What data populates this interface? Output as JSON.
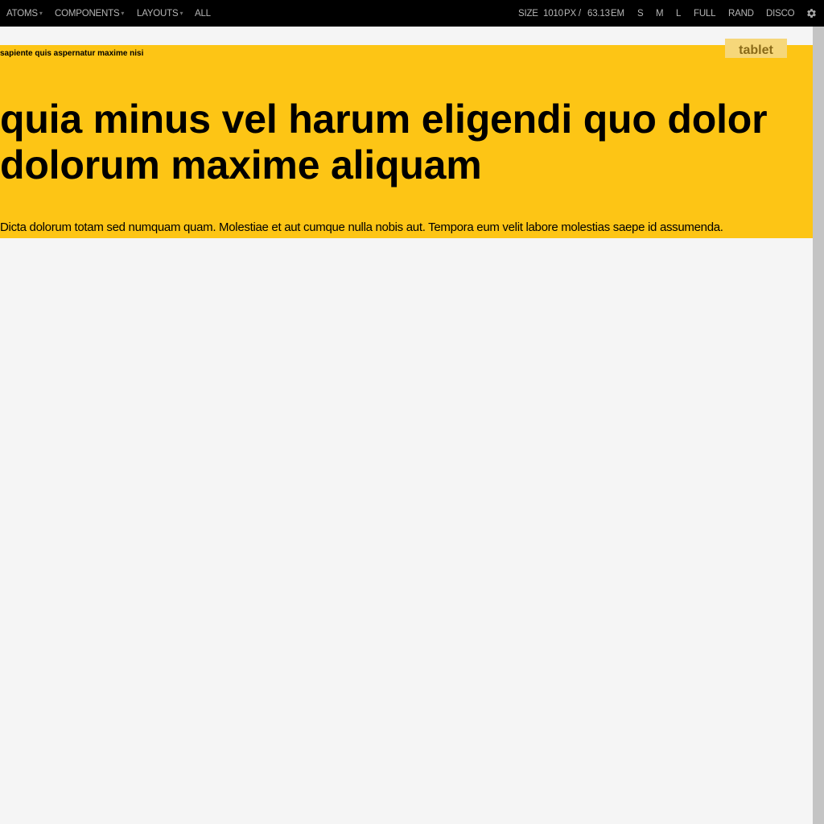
{
  "toolbar": {
    "nav": [
      {
        "label": "ATOMS",
        "caret": "▾"
      },
      {
        "label": "COMPONENTS",
        "caret": "▾"
      },
      {
        "label": "LAYOUTS",
        "caret": "▾"
      },
      {
        "label": "ALL"
      }
    ],
    "size_label": "SIZE",
    "size_px": "1010",
    "px_unit": "PX /",
    "size_em": "63.13",
    "em_unit": "EM",
    "buttons": [
      "S",
      "M",
      "L",
      "FULL",
      "RAND",
      "DISCO"
    ],
    "settings_icon": "gear-icon"
  },
  "viewport": {
    "breakpoint_tag": "tablet",
    "eyebrow": "sapiente quis aspernatur maxime nisi",
    "headline_line1": "quia minus vel harum eligendi quo dolor",
    "headline_line2": "dolorum maxime aliquam",
    "lede": "Dicta dolorum totam sed numquam quam. Molestiae et aut cumque nulla nobis aut. Tempora eum velit labore molestias saepe id assumenda."
  },
  "colors": {
    "toolbar_bg": "#000000",
    "toolbar_text": "#b5b5b5",
    "hero_bg": "#fdc515",
    "tag_bg": "#f6d77a",
    "page_bg": "#f5f5f5"
  }
}
